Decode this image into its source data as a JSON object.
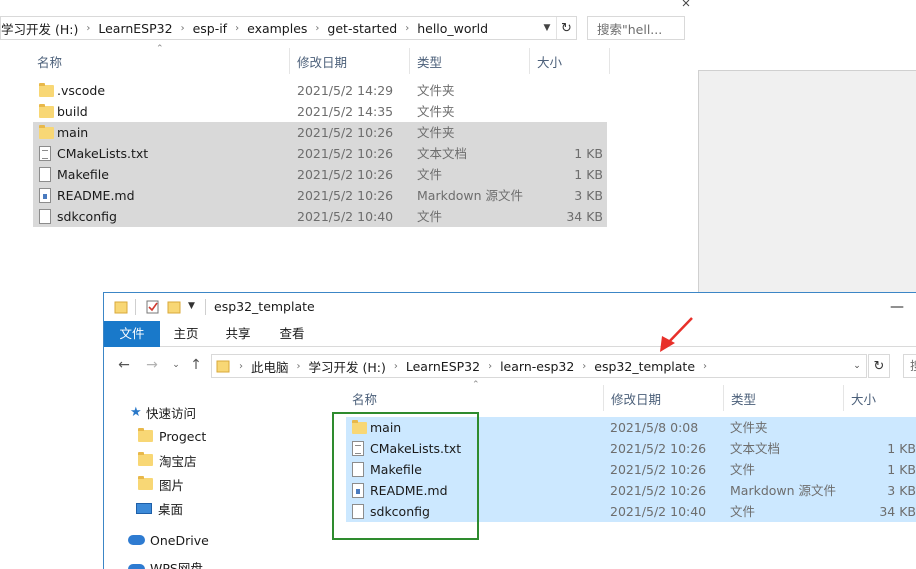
{
  "win1": {
    "breadcrumb": [
      "学习开发 (H:)",
      "LearnESP32",
      "esp-if",
      "examples",
      "get-started",
      "hello_world"
    ],
    "search_placeholder": "搜索\"hell...",
    "columns": {
      "name": "名称",
      "date": "修改日期",
      "type": "类型",
      "size": "大小"
    },
    "files": [
      {
        "name": ".vscode",
        "date": "2021/5/2 14:29",
        "type": "文件夹",
        "size": "",
        "icon": "folder-icon",
        "selected": false
      },
      {
        "name": "build",
        "date": "2021/5/2 14:35",
        "type": "文件夹",
        "size": "",
        "icon": "folder-icon",
        "selected": false
      },
      {
        "name": "main",
        "date": "2021/5/2 10:26",
        "type": "文件夹",
        "size": "",
        "icon": "folder-icon",
        "selected": true
      },
      {
        "name": "CMakeLists.txt",
        "date": "2021/5/2 10:26",
        "type": "文本文档",
        "size": "1 KB",
        "icon": "text-file-icon",
        "selected": true
      },
      {
        "name": "Makefile",
        "date": "2021/5/2 10:26",
        "type": "文件",
        "size": "1 KB",
        "icon": "file-icon",
        "selected": true
      },
      {
        "name": "README.md",
        "date": "2021/5/2 10:26",
        "type": "Markdown 源文件",
        "size": "3 KB",
        "icon": "markdown-file-icon",
        "selected": true
      },
      {
        "name": "sdkconfig",
        "date": "2021/5/2 10:40",
        "type": "文件",
        "size": "34 KB",
        "icon": "file-icon",
        "selected": true
      }
    ]
  },
  "win2": {
    "title": "esp32_template",
    "ribbon_tabs": [
      "文件",
      "主页",
      "共享",
      "查看"
    ],
    "breadcrumb": [
      "此电脑",
      "学习开发 (H:)",
      "LearnESP32",
      "learn-esp32",
      "esp32_template"
    ],
    "search_placeholder": "搜",
    "columns": {
      "name": "名称",
      "date": "修改日期",
      "type": "类型",
      "size": "大小"
    },
    "nav_pane": {
      "quick_access": "快速访问",
      "items": [
        "Progect",
        "淘宝店",
        "图片",
        "桌面"
      ],
      "onedrive": "OneDrive",
      "wps": "WPS网盘"
    },
    "files": [
      {
        "name": "main",
        "date": "2021/5/8 0:08",
        "type": "文件夹",
        "size": "",
        "icon": "folder-icon"
      },
      {
        "name": "CMakeLists.txt",
        "date": "2021/5/2 10:26",
        "type": "文本文档",
        "size": "1 KB",
        "icon": "text-file-icon"
      },
      {
        "name": "Makefile",
        "date": "2021/5/2 10:26",
        "type": "文件",
        "size": "1 KB",
        "icon": "file-icon"
      },
      {
        "name": "README.md",
        "date": "2021/5/2 10:26",
        "type": "Markdown 源文件",
        "size": "3 KB",
        "icon": "markdown-file-icon"
      },
      {
        "name": "sdkconfig",
        "date": "2021/5/2 10:40",
        "type": "文件",
        "size": "34 KB",
        "icon": "file-icon"
      }
    ]
  },
  "colors": {
    "selection_grey": "#d9d9d9",
    "selection_blue": "#cce8ff",
    "highlight_box": "#2e8b2e",
    "arrow": "#e8302a",
    "ribbon_file": "#1979ca"
  }
}
